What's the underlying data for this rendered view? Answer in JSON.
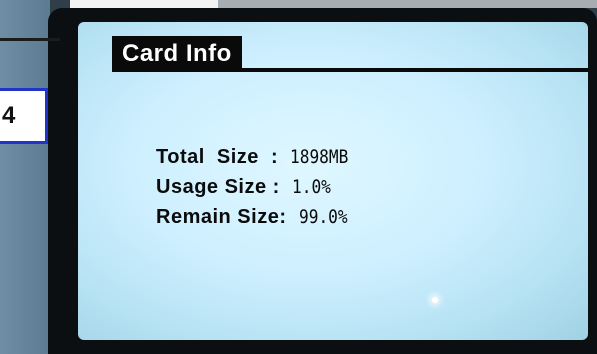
{
  "step_label": "4",
  "screen": {
    "title": "Card Info",
    "rows": [
      {
        "label": "Total  Size  : ",
        "value": "1898MB"
      },
      {
        "label": "Usage Size : ",
        "value": "1.0%"
      },
      {
        "label": "Remain Size: ",
        "value": "99.0%"
      }
    ]
  },
  "colors": {
    "screen_bg": "#cdefff",
    "title_bg": "#0a0a0a",
    "step_border": "#1f35c9"
  }
}
